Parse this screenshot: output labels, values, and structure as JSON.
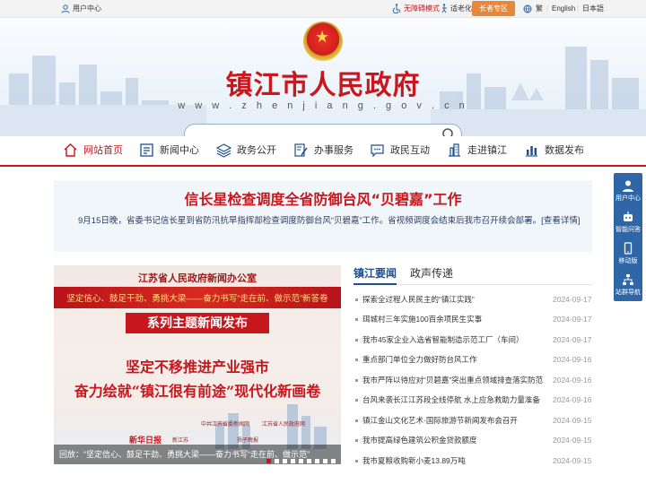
{
  "topbar": {
    "user_center": "用户中心",
    "accessibility": "无障碍模式",
    "elderly": "适老化",
    "senior_zone": "长者专区",
    "traditional": "繁",
    "english": "English",
    "japanese": "日本語"
  },
  "site": {
    "title": "镇江市人民政府",
    "url": "w w w . z h e n j i a n g . g o v . c n"
  },
  "nav": [
    {
      "label": "网站首页",
      "icon": "home-icon"
    },
    {
      "label": "新闻中心",
      "icon": "newspaper-icon"
    },
    {
      "label": "政务公开",
      "icon": "layers-icon"
    },
    {
      "label": "办事服务",
      "icon": "pen-icon"
    },
    {
      "label": "政民互动",
      "icon": "chat-icon"
    },
    {
      "label": "走进镇江",
      "icon": "building-icon"
    },
    {
      "label": "数据发布",
      "icon": "bar-chart-icon"
    }
  ],
  "sidefloat": [
    {
      "label": "用户中心",
      "icon": "user-icon"
    },
    {
      "label": "智能问答",
      "icon": "robot-icon"
    },
    {
      "label": "移动版",
      "icon": "mobile-icon"
    },
    {
      "label": "站群导航",
      "icon": "sitemap-icon"
    }
  ],
  "headline": {
    "title": "信长星检查调度全省防御台风“贝碧嘉”工作",
    "summary": "9月15日晚，省委书记信长星到省防汛抗旱指挥部检查调度防御台风“贝碧嘉”工作。省视频调度会结束后我市召开续会部署。[查看详情]"
  },
  "slider": {
    "header": "江苏省人民政府新闻办公室",
    "band": "坚定信心、鼓足干劲、勇挑大梁——奋力书写“走在前、做示范”新答卷",
    "series": "系列主题新闻发布",
    "line1": "坚定不移推进产业强市",
    "line2": "奋力绘就“镇江很有前途”现代化新画卷",
    "logos": [
      "新华日报",
      "新江苏",
      "中共江苏省委新闻网",
      "江苏省人民政府网",
      "扬子晚报"
    ],
    "caption": "回放：“坚定信心、鼓足干劲、勇挑大梁——奋力书写“走在前、做示范”",
    "dots": 9,
    "active_dot": 1
  },
  "tabs": [
    "镇江要闻",
    "政声传递"
  ],
  "news": [
    {
      "title": "探索全过程人民民主的“镇江实践”",
      "date": "2024-09-17"
    },
    {
      "title": "珥城村三年实施100百余项民生实事",
      "date": "2024-09-17"
    },
    {
      "title": "我市45家企业入选省智能制造示范工厂（车间）",
      "date": "2024-09-17"
    },
    {
      "title": "重点部门单位全力做好防台风工作",
      "date": "2024-09-16"
    },
    {
      "title": "我市严阵以待应对“贝碧嘉”突出重点领域排查落实防范",
      "date": "2024-09-16"
    },
    {
      "title": "台风来袭长江江苏段全线停航 水上应急救助力量准备",
      "date": "2024-09-16"
    },
    {
      "title": "镇江金山文化艺术·国际旅游节新闻发布会召开",
      "date": "2024-09-15"
    },
    {
      "title": "我市提高绿色建筑公积金贷款额度",
      "date": "2024-09-15"
    },
    {
      "title": "我市夏粮收购新小麦13.89万吨",
      "date": "2024-09-15"
    }
  ],
  "colors": {
    "brand_red": "#c8161d",
    "nav_blue": "#1d4e8f",
    "float_blue": "#2f66a8",
    "senior_orange": "#e8863a"
  }
}
